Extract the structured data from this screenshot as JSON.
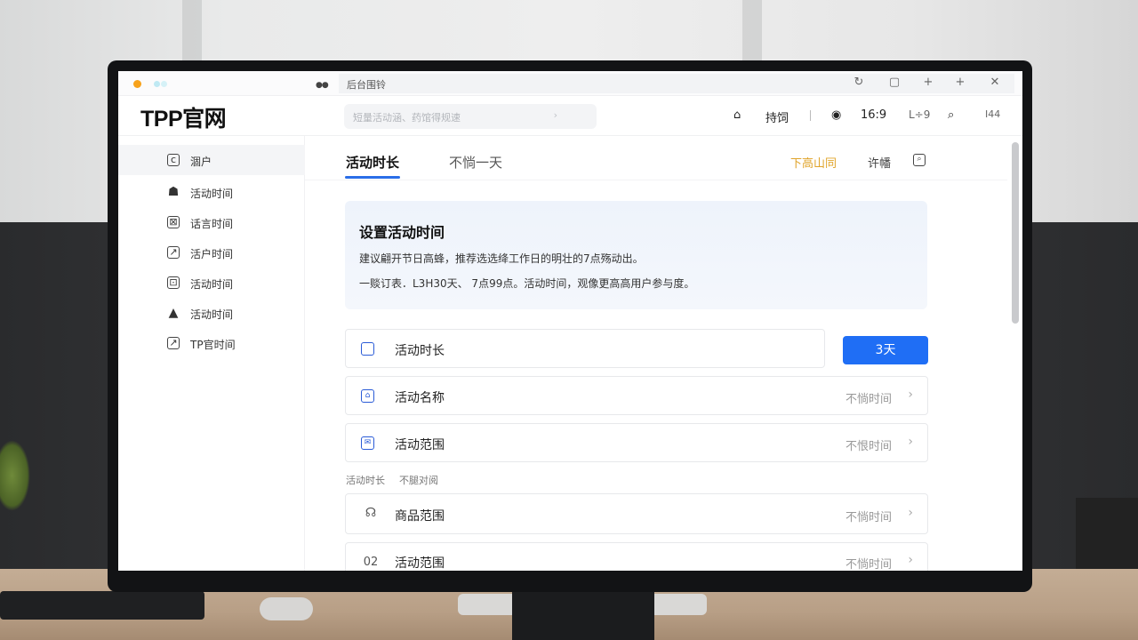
{
  "window": {
    "tab_mark": "●●",
    "url": "后台围铃",
    "controls": [
      "↻",
      "▢",
      "+",
      "+",
      "✕"
    ]
  },
  "header": {
    "logo": "TPP官网",
    "search_placeholder": "短量活动涵、药馆得规速",
    "search_arrow": "›",
    "home_icon": "⌂",
    "item1": "持饲",
    "globe_icon": "◉",
    "time": "16:9",
    "item3": "L÷9",
    "zoom_icon": "⌕",
    "item4": "I44"
  },
  "sidebar": {
    "items": [
      {
        "icon": "c",
        "label": "涸户"
      },
      {
        "icon": "☗",
        "label": "活动时间"
      },
      {
        "icon": "⊠",
        "label": "话言时间"
      },
      {
        "icon": "↗",
        "label": "活户时间"
      },
      {
        "icon": "⊡",
        "label": "活动时间"
      },
      {
        "icon": "▲",
        "label": "活动时间"
      },
      {
        "icon": "↗",
        "label": "TP官时间"
      }
    ]
  },
  "tabs": {
    "active": "活动时长",
    "second": "不惝一天",
    "link1": "下高山同",
    "link2": "许幡",
    "link_icon": "⌕"
  },
  "banner": {
    "title": "设置活动时间",
    "line1": "建议翩开节日高蜂，推荐选选绛工作日的明壮的7点殇动出。",
    "line2": "一赕订表．L3H30天、 7点99点。活动时间，观像更高高用户参与度。"
  },
  "rows": [
    {
      "icon": "",
      "label": "活动时长",
      "button": "3天"
    },
    {
      "icon": "⌂",
      "label": "活动名称",
      "value": "不惝时间"
    },
    {
      "icon": "✉",
      "label": "活动范围",
      "value": "不恨时间"
    }
  ],
  "section": {
    "label1": "活动时长",
    "label2": "不腿对阅"
  },
  "rows2": [
    {
      "icon": "☊",
      "label": "商品范围",
      "value": "不惝时间"
    },
    {
      "icon": "02",
      "label": "活动范围",
      "value": "不惝时间"
    }
  ],
  "chevron": "›",
  "colors": {
    "accent": "#1f6ef5",
    "link": "#e0a42a",
    "logo_dot": "#f7a21b"
  }
}
